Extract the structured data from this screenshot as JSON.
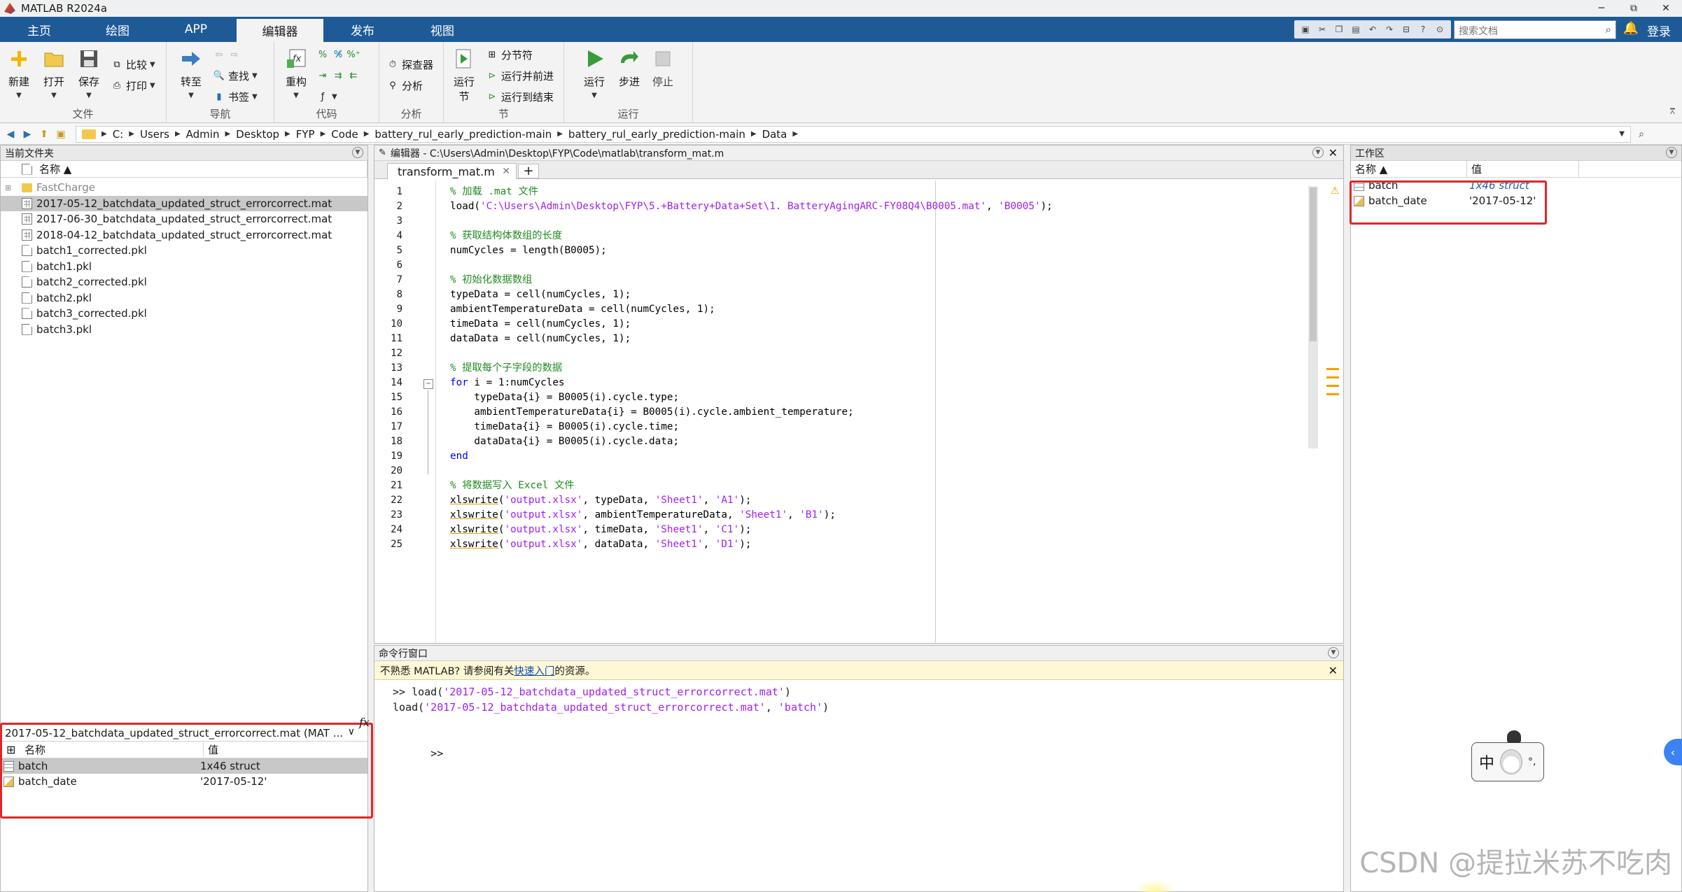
{
  "window": {
    "title": "MATLAB R2024a",
    "minimize": "─",
    "restore": "⧉",
    "close": "✕"
  },
  "ribbon_tabs": [
    "主页",
    "绘图",
    "APP",
    "编辑器",
    "发布",
    "视图"
  ],
  "active_tab": "编辑器",
  "toolbar": {
    "search_placeholder": "搜索文档",
    "login": "登录"
  },
  "ribbon": {
    "file": {
      "label": "文件",
      "new": "新建",
      "open": "打开",
      "save": "保存",
      "compare": "比较",
      "print": "打印"
    },
    "navigate": {
      "label": "导航",
      "goto": "转至",
      "find": "查找",
      "bookmark": "书签"
    },
    "code": {
      "label": "代码",
      "refactor": "重构"
    },
    "analyze": {
      "label": "分析",
      "explorer": "探查器",
      "analyze": "分析"
    },
    "section": {
      "label": "节",
      "run_section_l1": "运行",
      "run_section_l2": "节",
      "section_break": "分节符",
      "run_advance": "运行并前进",
      "run_to_end": "运行到结束"
    },
    "run": {
      "label": "运行",
      "run": "运行",
      "step": "步进",
      "stop": "停止"
    }
  },
  "path": [
    "C:",
    "Users",
    "Admin",
    "Desktop",
    "FYP",
    "Code",
    "battery_rul_early_prediction-main",
    "battery_rul_early_prediction-main",
    "Data"
  ],
  "current_folder": {
    "title": "当前文件夹",
    "col_name": "名称 ▲",
    "items": [
      {
        "name": "FastCharge",
        "type": "folder",
        "muted": true
      },
      {
        "name": "2017-05-12_batchdata_updated_struct_errorcorrect.mat",
        "type": "mat",
        "selected": true
      },
      {
        "name": "2017-06-30_batchdata_updated_struct_errorcorrect.mat",
        "type": "mat"
      },
      {
        "name": "2018-04-12_batchdata_updated_struct_errorcorrect.mat",
        "type": "mat"
      },
      {
        "name": "batch1_corrected.pkl",
        "type": "pkl"
      },
      {
        "name": "batch1.pkl",
        "type": "pkl"
      },
      {
        "name": "batch2_corrected.pkl",
        "type": "pkl"
      },
      {
        "name": "batch2.pkl",
        "type": "pkl"
      },
      {
        "name": "batch3_corrected.pkl",
        "type": "pkl"
      },
      {
        "name": "batch3.pkl",
        "type": "pkl"
      }
    ]
  },
  "details": {
    "title": "2017-05-12_batchdata_updated_struct_errorcorrect.mat  (MAT ...",
    "col_name": "名称",
    "col_value": "值",
    "rows": [
      {
        "name": "batch",
        "value": "1x46 struct",
        "selected": true
      },
      {
        "name": "batch_date",
        "value": "'2017-05-12'"
      }
    ]
  },
  "editor": {
    "title": "编辑器 - C:\\Users\\Admin\\Desktop\\FYP\\Code\\matlab\\transform_mat.m",
    "tab": "transform_mat.m",
    "plus": "+",
    "lines": [
      "1",
      "2",
      "3",
      "4",
      "5",
      "6",
      "7",
      "8",
      "9",
      "10",
      "11",
      "12",
      "13",
      "14",
      "15",
      "16",
      "17",
      "18",
      "19",
      "20",
      "21",
      "22",
      "23",
      "24",
      "25"
    ],
    "code": {
      "l1": "% 加载 .mat 文件",
      "l2a": "load(",
      "l2s": "'C:\\Users\\Admin\\Desktop\\FYP\\5.+Battery+Data+Set\\1. BatteryAgingARC-FY08Q4\\B0005.mat'",
      "l2b": ", ",
      "l2s2": "'B0005'",
      "l2c": ");",
      "l4": "% 获取结构体数组的长度",
      "l5": "numCycles = length(B0005);",
      "l7": "% 初始化数据数组",
      "l8": "typeData = cell(numCycles, 1);",
      "l9": "ambientTemperatureData = cell(numCycles, 1);",
      "l10": "timeData = cell(numCycles, 1);",
      "l11": "dataData = cell(numCycles, 1);",
      "l13": "% 提取每个子字段的数据",
      "l14k": "for",
      "l14": " i = 1:numCycles",
      "l15": "    typeData{i} = B0005(i).cycle.type;",
      "l16": "    ambientTemperatureData{i} = B0005(i).cycle.ambient_temperature;",
      "l17": "    timeData{i} = B0005(i).cycle.time;",
      "l18": "    dataData{i} = B0005(i).cycle.data;",
      "l19": "end",
      "l21": "% 将数据写入 Excel 文件",
      "l22f": "xlswrite",
      "l22a": "(",
      "l22s1": "'output.xlsx'",
      "l22b": ", typeData, ",
      "l22s2": "'Sheet1'",
      "l22c": ", ",
      "l22s3": "'A1'",
      "l22d": ");",
      "l23f": "xlswrite",
      "l23a": "(",
      "l23s1": "'output.xlsx'",
      "l23b": ", ambientTemperatureData, ",
      "l23s2": "'Sheet1'",
      "l23c": ", ",
      "l23s3": "'B1'",
      "l23d": ");",
      "l24f": "xlswrite",
      "l24a": "(",
      "l24s1": "'output.xlsx'",
      "l24b": ", timeData, ",
      "l24s2": "'Sheet1'",
      "l24c": ", ",
      "l24s3": "'C1'",
      "l24d": ");",
      "l25f": "xlswrite",
      "l25a": "(",
      "l25s1": "'output.xlsx'",
      "l25b": ", dataData, ",
      "l25s2": "'Sheet1'",
      "l25c": ", ",
      "l25s3": "'D1'",
      "l25d": ");"
    }
  },
  "command": {
    "title": "命令行窗口",
    "info_pre": "不熟悉 MATLAB? 请参阅有关",
    "info_link": "快速入门",
    "info_post": "的资源。",
    "l1a": ">> load(",
    "l1s": "'2017-05-12_batchdata_updated_struct_errorcorrect.mat'",
    "l1b": ")",
    "l2a": "load(",
    "l2s": "'2017-05-12_batchdata_updated_struct_errorcorrect.mat'",
    "l2b": ", ",
    "l2s2": "'batch'",
    "l2c": ")",
    "prompt": ">>",
    "fx": "fx"
  },
  "workspace": {
    "title": "工作区",
    "col_name": "名称 ▲",
    "col_value": "值",
    "rows": [
      {
        "name": "batch",
        "value": "1x46 struct"
      },
      {
        "name": "batch_date",
        "value": "'2017-05-12'"
      }
    ]
  },
  "ime": {
    "char": "中",
    "extra": "°,"
  },
  "watermark": "CSDN @提拉米苏不吃肉",
  "colors": {
    "accent": "#1e5a96",
    "highlight": "#e0262b",
    "comment": "#228b22",
    "string": "#a020f0",
    "keyword": "#0000ff"
  }
}
